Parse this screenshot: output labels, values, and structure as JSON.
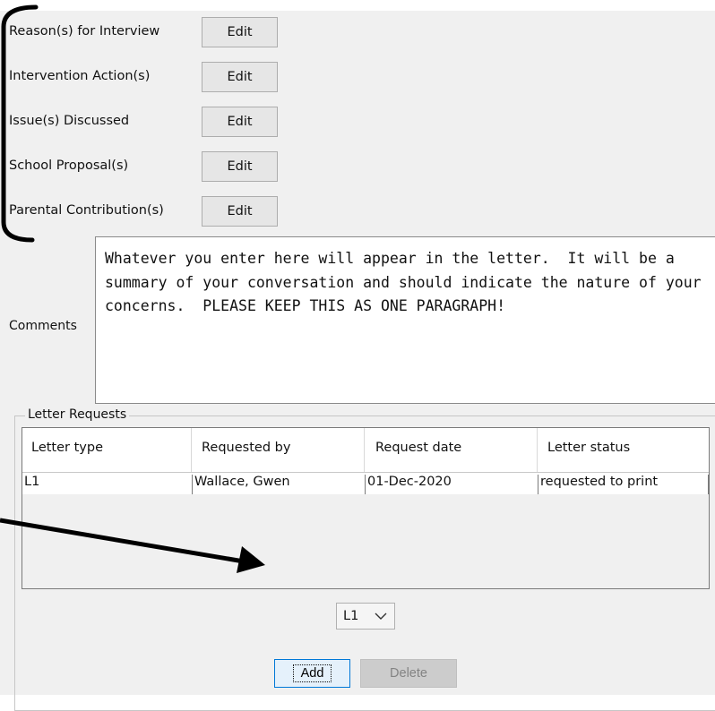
{
  "form": {
    "rows": [
      {
        "label": "Reason(s) for Interview",
        "button": "Edit"
      },
      {
        "label": "Intervention Action(s)",
        "button": "Edit"
      },
      {
        "label": "Issue(s) Discussed",
        "button": "Edit"
      },
      {
        "label": "School Proposal(s)",
        "button": "Edit"
      },
      {
        "label": "Parental Contribution(s)",
        "button": "Edit"
      }
    ],
    "comments_label": "Comments",
    "comments_value": "Whatever you enter here will appear in the letter.  It will be a summary of your conversation and should indicate the nature of your concerns.  PLEASE KEEP THIS AS ONE PARAGRAPH!"
  },
  "letter_requests": {
    "title": "Letter Requests",
    "columns": [
      "Letter type",
      "Requested by",
      "Request date",
      "Letter status"
    ],
    "rows": [
      [
        "L1",
        "Wallace, Gwen",
        "01-Dec-2020",
        "requested to print"
      ]
    ],
    "letter_type_select": "L1",
    "add_label": "Add",
    "delete_label": "Delete"
  },
  "icons": {
    "select_arrow": "chevron-down-icon"
  },
  "colors": {
    "panel_bg": "#f0f0f0",
    "focus_border": "#0078d7",
    "annotation": "#000000"
  }
}
